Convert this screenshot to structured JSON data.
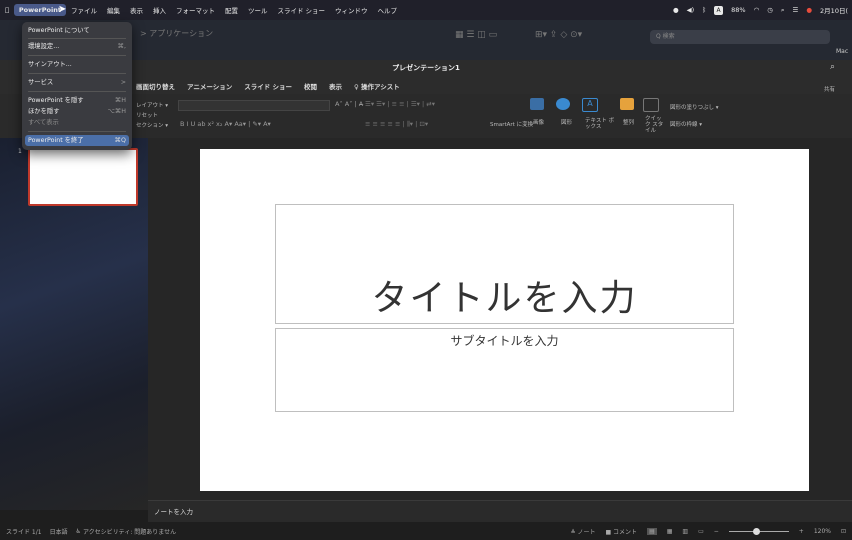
{
  "menubar": {
    "apple": "",
    "items": [
      "PowerPoint",
      "ファイル",
      "編集",
      "表示",
      "挿入",
      "フォーマット",
      "配置",
      "ツール",
      "スライド ショー",
      "ウィンドウ",
      "ヘルプ"
    ],
    "date": "2月10日(",
    "status_icons": [
      "record-icon",
      "volume-icon",
      "bluetooth-icon",
      "input-method-icon",
      "battery-icon",
      "wifi-icon",
      "clock-icon",
      "spotlight-icon",
      "control-center-icon",
      "notification-icon"
    ],
    "input_label": "A",
    "battery_label": "88%"
  },
  "appbar": {
    "back_label": "> アプリケーション",
    "search_placeholder": "Q 検索",
    "right_label": "Mac"
  },
  "app_menu": {
    "items": [
      {
        "label": "PowerPoint について",
        "shortcut": ""
      },
      {
        "label": "環境設定...",
        "shortcut": "⌘,"
      },
      {
        "label": "サインアウト...",
        "shortcut": ""
      },
      {
        "label": "サービス",
        "shortcut": ">"
      },
      {
        "label": "PowerPoint を隠す",
        "shortcut": "⌘H"
      },
      {
        "label": "ほかを隠す",
        "shortcut": "⌥⌘H"
      },
      {
        "label": "すべて表示",
        "shortcut": ""
      },
      {
        "label": "PowerPoint を終了",
        "shortcut": "⌘Q"
      }
    ]
  },
  "titlebar": {
    "doc_title": "プレゼンテーション1",
    "search_icon": "search-icon"
  },
  "ribbon_tabs": [
    "画面切り替え",
    "アニメーション",
    "スライド ショー",
    "校閲",
    "表示",
    "♀ 操作アシスト"
  ],
  "ribbon": {
    "share": "共有",
    "layout": "レイアウト ▾",
    "reset": "リセット",
    "section": "セクション ▾",
    "smartart": "SmartArt に変換",
    "image": "画像",
    "shape": "図形",
    "textbox": "テキスト ボックス",
    "arrange": "整列",
    "quickstyle": "クイック スタイル",
    "shape_fill": "図形の塗りつぶし ▾",
    "shape_outline": "図形の枠線 ▾"
  },
  "thumbnail": {
    "number": "1"
  },
  "slide": {
    "title_placeholder": "タイトルを入力",
    "subtitle_placeholder": "サブタイトルを入力"
  },
  "notes": {
    "placeholder": "ノートを入力"
  },
  "statusbar": {
    "slide_info": "スライド 1/1",
    "language": "日本語",
    "accessibility": "アクセシビリティ: 問題ありません",
    "notes_label": "ノート",
    "comments_label": "コメント",
    "zoom": "120%",
    "zoom_fraction": 0.47
  }
}
